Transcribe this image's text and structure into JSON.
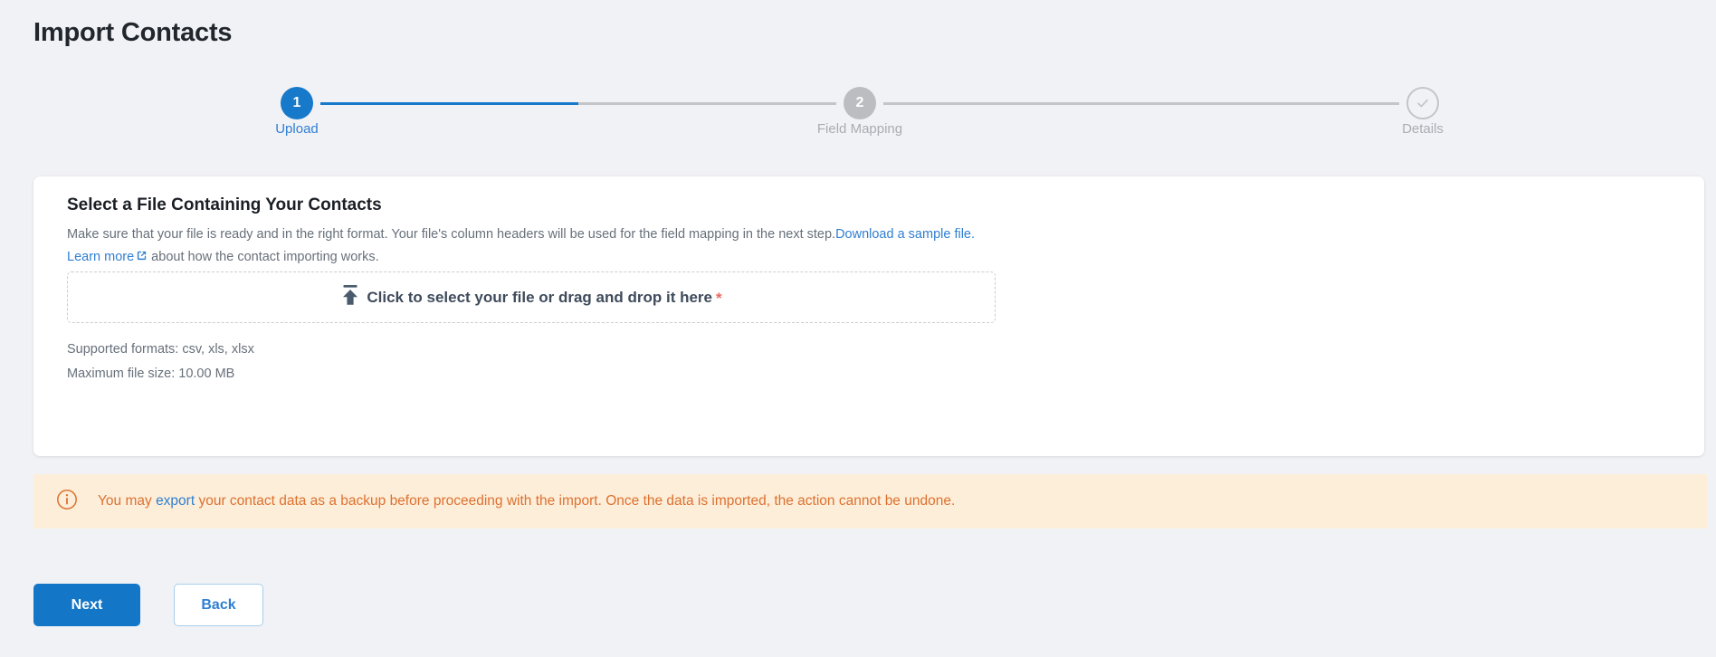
{
  "page": {
    "title": "Import Contacts"
  },
  "stepper": {
    "steps": [
      {
        "number": "1",
        "label": "Upload",
        "state": "active",
        "icon": ""
      },
      {
        "number": "2",
        "label": "Field Mapping",
        "state": "inactive",
        "icon": ""
      },
      {
        "number": "",
        "label": "Details",
        "state": "complete",
        "icon": "check-circle-icon"
      }
    ],
    "progress_percent": 50,
    "active_color": "#1679c9",
    "inactive_color": "#c4c5c9"
  },
  "card": {
    "title": "Select a File Containing Your Contacts",
    "description_part1": "Make sure that your file is ready and in the right format. Your file's column headers will be used for the field mapping in the next step.",
    "sample_link_label": "Download a sample file.",
    "learn_more_label": "Learn more",
    "learn_more_suffix": " about how the contact importing works.",
    "dropzone": {
      "label": "Click to select your file or drag and drop it here",
      "required_marker": "*",
      "icon": "upload-icon"
    },
    "supported_formats": "Supported formats: csv, xls, xlsx",
    "max_file_size": "Maximum file size: 10.00 MB"
  },
  "banner": {
    "icon": "info-circle-icon",
    "text_before_link": "You may ",
    "link_label": "export",
    "text_after_link": " your contact data as a backup before proceeding with the import. Once the data is imported, the action cannot be undone.",
    "background_color": "#fdeed9",
    "text_color": "#dd7130"
  },
  "footer": {
    "next_label": "Next",
    "back_label": "Back",
    "primary_color": "#1476c6"
  }
}
